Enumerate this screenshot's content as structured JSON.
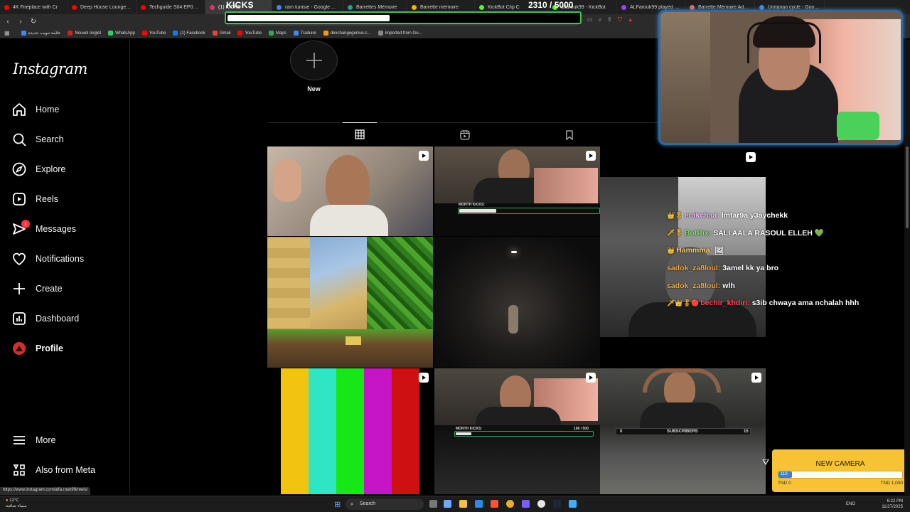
{
  "browser": {
    "tabs": [
      {
        "label": "4K Fireplace with Cr",
        "color": "#ff0000"
      },
      {
        "label": "Deep House Lounge Se",
        "color": "#ff0000"
      },
      {
        "label": "Techguide S04 EP01 | لعبة",
        "color": "#ff0000"
      },
      {
        "label": "(1) KICKS",
        "color": "#e1306c",
        "active": true
      },
      {
        "label": "ram tunisie - Google Search",
        "color": "#4285f4"
      },
      {
        "label": "Barrettes Mémoire",
        "color": "#2a9d8f"
      },
      {
        "label": "Barrette mémoire",
        "color": "#f4b400"
      },
      {
        "label": "KickBot Clip C",
        "color": "#53fc18"
      },
      {
        "label": "alfarouk99 - KickBot",
        "color": "#53fc18"
      },
      {
        "label": "ALFarouk99 played by hi",
        "color": "#9146ff"
      },
      {
        "label": "Barrette Mémoire Adata 16",
        "color": "#e66"
      },
      {
        "label": "Unitarian cycle - Google S",
        "color": "#4285f4"
      }
    ],
    "url": "instagram.com/alfa.rouk99",
    "bookmarks": [
      {
        "label": "علامة تبويب جديدة",
        "color": "#4285f4"
      },
      {
        "label": "Nouvel onglet",
        "color": "#cc2222"
      },
      {
        "label": "WhatsApp",
        "color": "#25d366"
      },
      {
        "label": "YouTube",
        "color": "#ff0000"
      },
      {
        "label": "(1) Facebook",
        "color": "#1877f2"
      },
      {
        "label": "Gmail",
        "color": "#ea4335"
      },
      {
        "label": "YouTube",
        "color": "#ff0000"
      },
      {
        "label": "Maps",
        "color": "#34a853"
      },
      {
        "label": "Traduire",
        "color": "#4285f4"
      },
      {
        "label": "dexchangegenius.c...",
        "color": "#ff9900"
      },
      {
        "label": "Imported from Go...",
        "color": "#888888"
      }
    ],
    "status_url": "https://www.instagram.com/alfa.rouk99/reels/"
  },
  "sidebar": {
    "logo": "Instagram",
    "items": [
      {
        "label": "Home",
        "icon": "home-icon"
      },
      {
        "label": "Search",
        "icon": "search-icon"
      },
      {
        "label": "Explore",
        "icon": "compass-icon"
      },
      {
        "label": "Reels",
        "icon": "reels-icon"
      },
      {
        "label": "Messages",
        "icon": "messenger-icon",
        "badge": "1"
      },
      {
        "label": "Notifications",
        "icon": "heart-icon"
      },
      {
        "label": "Create",
        "icon": "plus-icon"
      },
      {
        "label": "Dashboard",
        "icon": "chart-icon"
      },
      {
        "label": "Profile",
        "icon": "avatar-icon"
      }
    ],
    "bottom": [
      {
        "label": "More",
        "icon": "menu-icon"
      },
      {
        "label": "Also from Meta",
        "icon": "meta-icon"
      }
    ]
  },
  "profile": {
    "new_story_label": "New",
    "tabs": [
      "posts-grid",
      "reels",
      "saved"
    ]
  },
  "overlay": {
    "kicks_title": "KICKS",
    "kicks_count": "2310",
    "kicks_goal": "/ 5000",
    "kicks_progress": 0.462,
    "month_kicks_label": "MONTH KICKS:",
    "month_kicks_value": "106 / 500",
    "subscribers_label": "SUBSCRIBERS",
    "subscribers_min": "0",
    "subscribers_max": "15",
    "chat": [
      {
        "badges": "👑🎖",
        "user": "erakchaa:",
        "user_color": "#f0b6ff",
        "msg": "lmtar9a y3aychekk"
      },
      {
        "badges": "🗡🎖",
        "user": "BotRix:",
        "user_color": "#7ce26b",
        "msg": "SALI AALA RASOUL ELLEH 💚"
      },
      {
        "badges": "👑",
        "user": "Hammma:",
        "user_color": "#f0d074",
        "msg": "🖼"
      },
      {
        "badges": "",
        "user": "sadok_za8loul:",
        "user_color": "#f0a848",
        "msg": "3amel kk ya bro"
      },
      {
        "badges": "",
        "user": "sadok_za8loul:",
        "user_color": "#f0a848",
        "msg": "wlh"
      },
      {
        "badges": "🗡👑🎖🔴",
        "user": "bechir_khdiri:",
        "user_color": "#ff4a5a",
        "msg": "s3ib chwaya ama nchalah hhh"
      }
    ],
    "goal_title": "NEW CAMERA",
    "goal_value": "110",
    "goal_progress": 0.11,
    "goal_min": "TND 0",
    "goal_max": "TND 1,000"
  },
  "taskbar": {
    "weather_temp": "12°C",
    "weather_desc": "سماء صافية",
    "search_label": "Search",
    "lang": "ENG",
    "time": "6:22 PM",
    "date": "11/27/2025"
  }
}
